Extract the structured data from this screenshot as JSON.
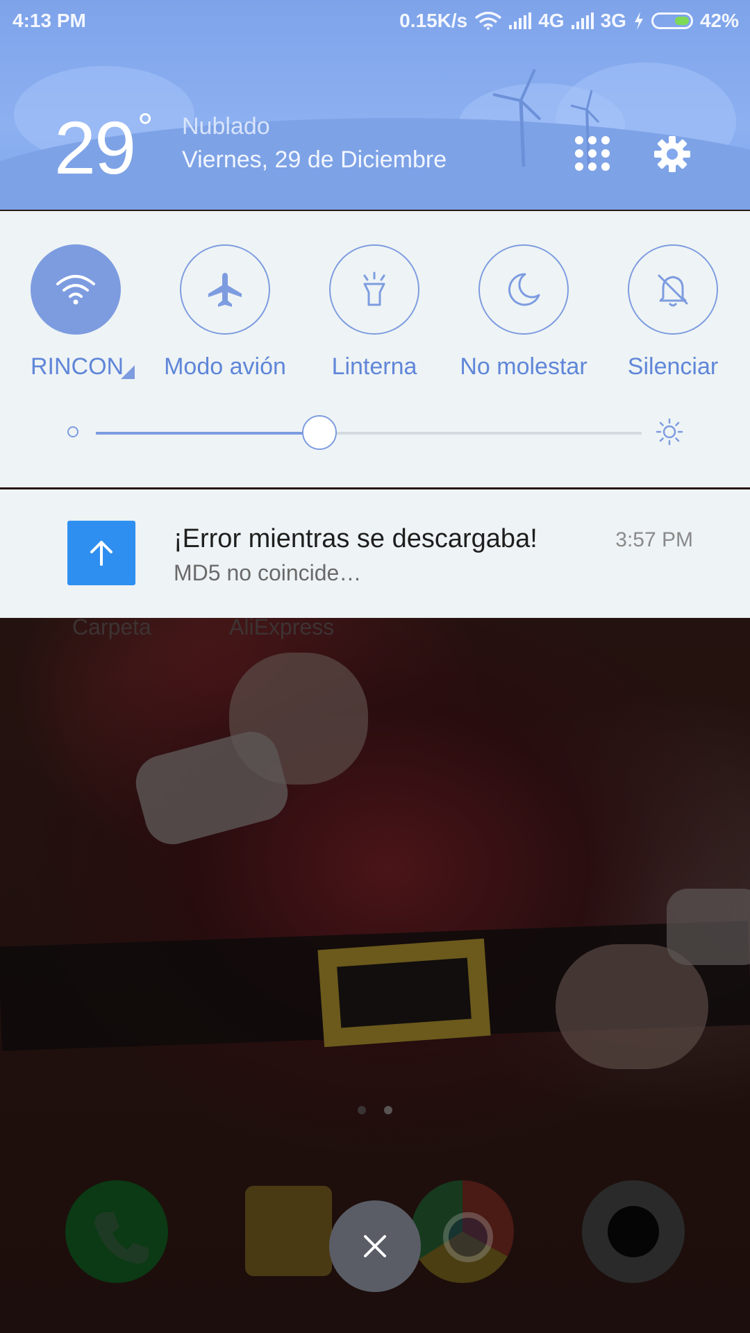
{
  "status_bar": {
    "time": "4:13 PM",
    "speed": "0.15K/s",
    "network1": "4G",
    "network2": "3G",
    "battery_percent": "42%",
    "battery_level": 0.42,
    "icons": [
      "wifi-icon",
      "signal-icon",
      "signal-icon",
      "charging-icon",
      "battery-icon"
    ]
  },
  "weather": {
    "temperature": "29",
    "degree_symbol": "°",
    "condition": "Nublado",
    "date": "Viernes, 29 de Diciembre"
  },
  "header_actions": {
    "grid_icon": "apps-grid-icon",
    "settings_icon": "gear-icon"
  },
  "quick_settings": {
    "toggles": [
      {
        "label": "RINCON",
        "icon": "wifi-icon",
        "active": true
      },
      {
        "label": "Modo avión",
        "icon": "airplane-icon",
        "active": false
      },
      {
        "label": "Linterna",
        "icon": "flashlight-icon",
        "active": false
      },
      {
        "label": "No molestar",
        "icon": "moon-icon",
        "active": false
      },
      {
        "label": "Silenciar",
        "icon": "bell-off-icon",
        "active": false
      }
    ],
    "brightness": 0.41,
    "accent_color": "#7d9ce0"
  },
  "notification": {
    "icon": "upload-arrow-icon",
    "title": "¡Error mientras se descargaba!",
    "text": "MD5 no coincide…",
    "time": "3:57 PM",
    "icon_color": "#2f8ff0"
  },
  "home_screen": {
    "labels": [
      "Carpeta",
      "AliExpress"
    ],
    "dock": [
      "phone-icon",
      "messages-icon",
      "chrome-icon",
      "camera-icon"
    ]
  },
  "close_button": {
    "icon": "close-icon"
  }
}
